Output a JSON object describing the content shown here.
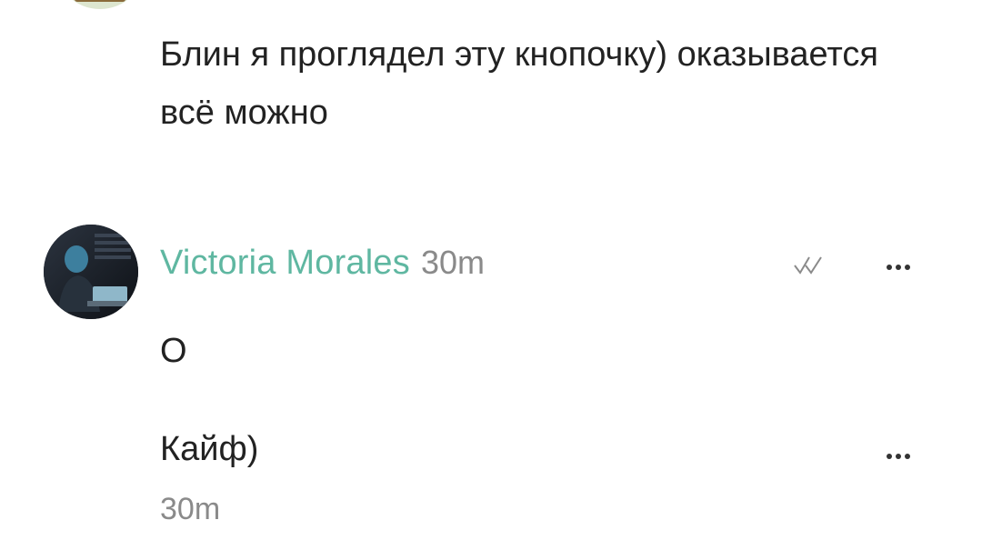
{
  "previous_comment": {
    "text": "Блин я проглядел эту кнопочку) оказывается всё можно"
  },
  "comment": {
    "author": "Victoria Morales",
    "time": "30m",
    "messages": [
      {
        "text": "О"
      },
      {
        "text": "Кайф)",
        "time": "30m"
      }
    ]
  },
  "colors": {
    "author_name": "#5fb7a1",
    "muted_text": "#8a8a8a",
    "body_text": "#222222"
  },
  "icons": {
    "read_status": "double-check-icon",
    "more": "more-horizontal-icon"
  }
}
